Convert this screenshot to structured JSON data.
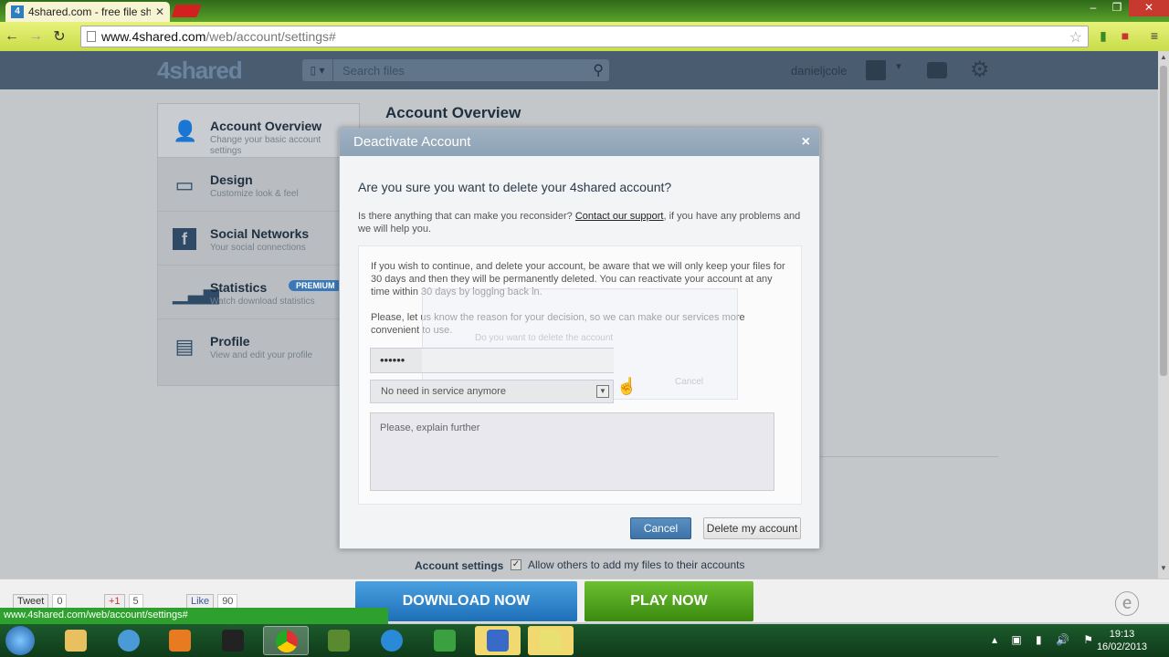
{
  "browser": {
    "tab_title": "4shared.com - free file sh",
    "tab_favicon": "4",
    "url_host": "www.4shared.com",
    "url_path": "/web/account/settings#",
    "status_url": "www.4shared.com/web/account/settings#"
  },
  "header": {
    "logo": "4shared",
    "search_placeholder": "Search files",
    "username": "danieljcole"
  },
  "sidebar": {
    "items": [
      {
        "label": "Account Overview",
        "sub": "Change your basic account settings",
        "icon": "person-icon"
      },
      {
        "label": "Design",
        "sub": "Customize look & feel",
        "icon": "monitor-icon"
      },
      {
        "label": "Social Networks",
        "sub": "Your social connections",
        "icon": "facebook-icon"
      },
      {
        "label": "Statistics",
        "sub": "Watch download statistics",
        "icon": "bar-chart-icon",
        "badge": "PREMIUM"
      },
      {
        "label": "Profile",
        "sub": "View and edit your profile",
        "icon": "id-card-icon"
      }
    ]
  },
  "main": {
    "title": "Account Overview",
    "account_settings_label": "Account settings",
    "allow_label": "Allow others to add my files to their accounts"
  },
  "modal": {
    "title": "Deactivate Account",
    "question": "Are you sure you want to delete your 4shared account?",
    "reconsider_pre": "Is there anything that can make you reconsider? ",
    "reconsider_link": "Contact our support",
    "reconsider_post": ", if you have any problems and we will help you.",
    "warning": "If you wish to continue, and delete your account, be aware that we will only keep your files for 30 days and then they will be permanently deleted. You can reactivate your account at any time within 30 days by logging back in.",
    "reason_prompt": "Please, let us know the reason for your decision, so we can make our services more convenient to use.",
    "password_value": "••••••",
    "reason_selected": "No need in service anymore",
    "explain_placeholder": "Please, explain further",
    "ghost_text": "Do you want to delete the account",
    "ghost_cancel": "Cancel",
    "cancel_label": "Cancel",
    "delete_label": "Delete my account"
  },
  "bottom": {
    "tweet_label": "Tweet",
    "tweet_count": "0",
    "gplus_label": "+1",
    "gplus_count": "5",
    "like_label": "Like",
    "like_count": "90",
    "download_label": "DOWNLOAD NOW",
    "play_label": "PLAY NOW"
  },
  "taskbar": {
    "time": "19:13",
    "date": "16/02/2013"
  }
}
